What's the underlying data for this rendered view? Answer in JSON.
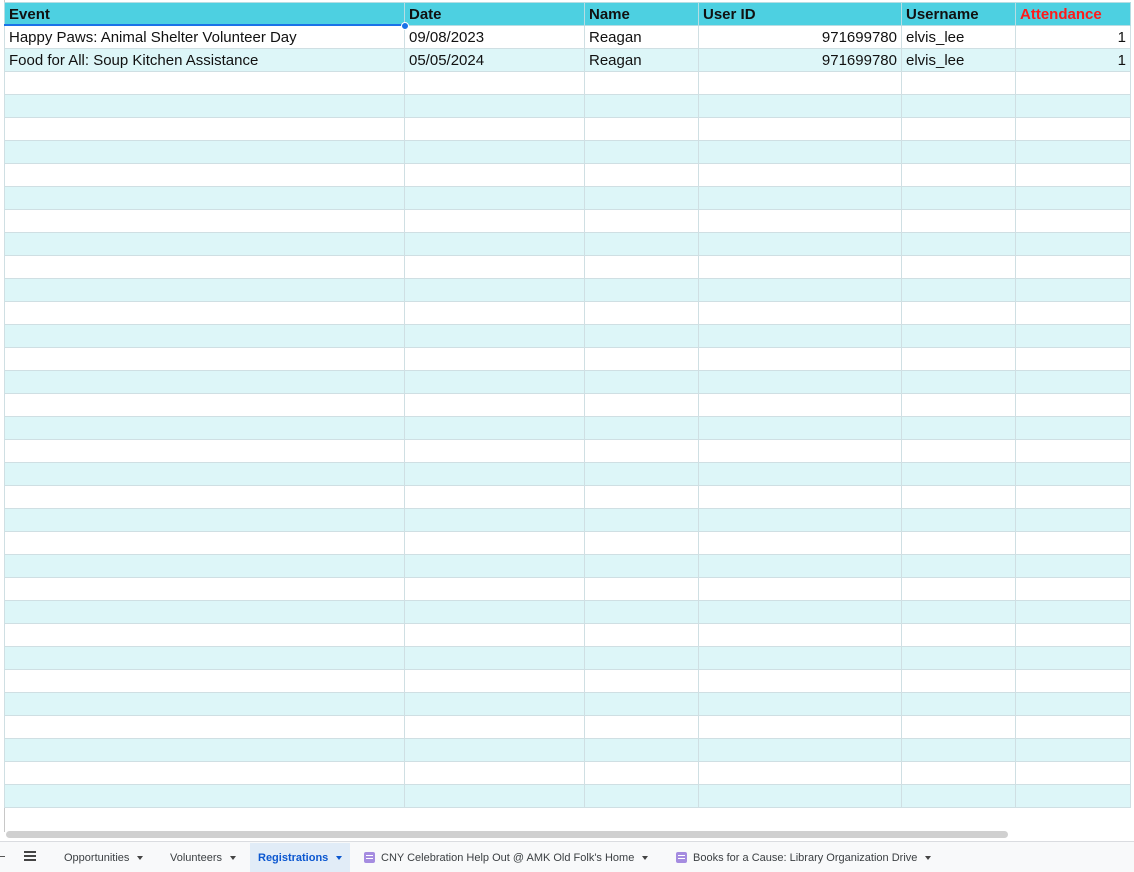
{
  "sheet": {
    "headers": [
      "Event",
      "Date",
      "Name",
      "User ID",
      "Username",
      "Attendance"
    ],
    "rows": [
      [
        "Happy Paws: Animal Shelter Volunteer Day",
        "09/08/2023",
        "Reagan",
        "971699780",
        "elvis_lee",
        "1"
      ],
      [
        "Food for All: Soup Kitchen Assistance",
        "05/05/2024",
        "Reagan",
        "971699780",
        "elvis_lee",
        "1"
      ]
    ]
  },
  "colors": {
    "header_bg": "#4dd0e1",
    "band_bg": "#ddf6f8",
    "attendance_header": "#ff1a1a",
    "active_tab": "#0b57d0"
  },
  "tabs": [
    {
      "label": "Opportunities",
      "icon": null,
      "active": false
    },
    {
      "label": "Volunteers",
      "icon": null,
      "active": false
    },
    {
      "label": "Registrations",
      "icon": null,
      "active": true
    },
    {
      "label": "CNY Celebration Help Out @ AMK Old Folk's Home",
      "icon": "form-icon",
      "active": false
    },
    {
      "label": "Books for a Cause: Library Organization Drive",
      "icon": "form-icon",
      "active": false
    }
  ]
}
